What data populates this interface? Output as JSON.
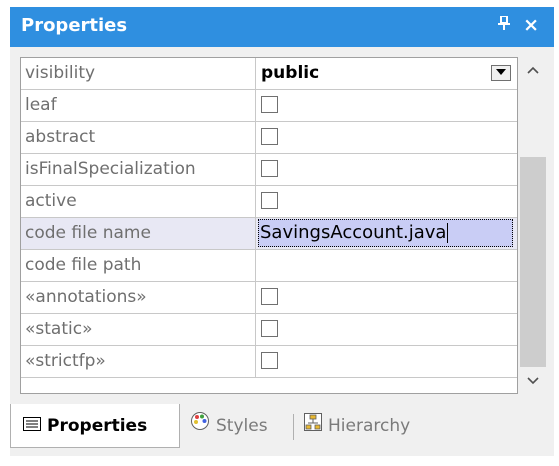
{
  "window": {
    "title": "Properties",
    "pin_glyph": "ᵼ",
    "close_glyph": "×"
  },
  "rows": [
    {
      "name": "visibility",
      "type": "select",
      "value": "public"
    },
    {
      "name": "leaf",
      "type": "checkbox",
      "checked": false
    },
    {
      "name": "abstract",
      "type": "checkbox",
      "checked": false
    },
    {
      "name": "isFinalSpecialization",
      "type": "checkbox",
      "checked": false
    },
    {
      "name": "active",
      "type": "checkbox",
      "checked": false
    },
    {
      "name": "code file name",
      "type": "text-editing",
      "value": "SavingsAccount.java"
    },
    {
      "name": "code file path",
      "type": "text",
      "value": ""
    },
    {
      "name": "«annotations»",
      "type": "checkbox",
      "checked": false
    },
    {
      "name": "«static»",
      "type": "checkbox",
      "checked": false
    },
    {
      "name": "«strictfp»",
      "type": "checkbox",
      "checked": false
    }
  ],
  "scrollbar": {
    "up_glyph": "˄",
    "down_glyph": "˅"
  },
  "tabs": [
    {
      "label": "Properties",
      "icon": "properties-icon",
      "active": true
    },
    {
      "label": "Styles",
      "icon": "palette-icon",
      "active": false
    },
    {
      "label": "Hierarchy",
      "icon": "hierarchy-icon",
      "active": false
    }
  ],
  "colors": {
    "titlebar": "#2f8fe0",
    "selected_row": "#e8e8f4",
    "edit_highlight": "#c9cdf5"
  }
}
